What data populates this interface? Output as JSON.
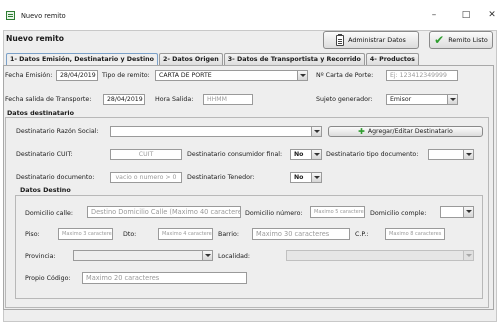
{
  "window": {
    "title": "Nuevo remito",
    "minimize": "–",
    "maximize": "□",
    "close": "✕"
  },
  "header": {
    "title": "Nuevo remito",
    "admin_button": "Administrar Datos",
    "ready_button": "Remito Listo"
  },
  "tabs": [
    {
      "label": "1- Datos Emisión, Destinatario y Destino",
      "active": true
    },
    {
      "label": "2- Datos Origen",
      "active": false
    },
    {
      "label": "3- Datos de Transportista y Recorrido",
      "active": false
    },
    {
      "label": "4- Productos",
      "active": false
    }
  ],
  "emission": {
    "fecha_emision_label": "Fecha Emisión:",
    "fecha_emision_value": "28/04/2019",
    "tipo_remito_label": "Tipo de remito:",
    "tipo_remito_value": "CARTA DE PORTE",
    "carta_porte_label": "Nº Carta de Porte:",
    "carta_porte_placeholder": "Ej: 123412349999",
    "fecha_salida_label": "Fecha salida de Transporte:",
    "fecha_salida_value": "28/04/2019",
    "hora_salida_label": "Hora Salida:",
    "hora_salida_placeholder": "HHMM",
    "sujeto_label": "Sujeto generador:",
    "sujeto_value": "Emisor"
  },
  "destinatario": {
    "section_title": "Datos destinatario",
    "razon_social_label": "Destinatario Razón Social:",
    "razon_social_value": "",
    "add_edit_button": "Agregar/Editar Destinatario",
    "cuit_label": "Destinatario CUIT:",
    "cuit_placeholder": "CUIT",
    "consumidor_label": "Destinatario consumidor final:",
    "consumidor_value": "No",
    "tipo_doc_label": "Destinatario tipo documento:",
    "tipo_doc_value": "",
    "documento_label": "Destinatario documento:",
    "documento_placeholder": "vacio o numero > 0",
    "tenedor_label": "Destinatario Tenedor:",
    "tenedor_value": "No"
  },
  "destino": {
    "section_title": "Datos Destino",
    "domicilio_calle_label": "Domicilio calle:",
    "domicilio_calle_placeholder": "Destino Domicilio Calle (Maximo 40 caracteres)",
    "domicilio_numero_label": "Domicilio número:",
    "domicilio_numero_placeholder": "Maximo 5 caracteres",
    "domicilio_comple_label": "Domicilio comple:",
    "domicilio_comple_value": "",
    "piso_label": "Piso:",
    "piso_placeholder": "Maximo 3 caracteres",
    "dto_label": "Dto:",
    "dto_placeholder": "Maximo 4 caracteres",
    "barrio_label": "Barrio:",
    "barrio_placeholder": "Maximo 30 caracteres",
    "cp_label": "C.P.:",
    "cp_placeholder": "Maximo 8 caracteres",
    "provincia_label": "Provincia:",
    "provincia_value": "",
    "localidad_label": "Localidad:",
    "localidad_value": "",
    "propio_codigo_label": "Propio Código:",
    "propio_codigo_placeholder": "Maximo 20 caracteres"
  }
}
